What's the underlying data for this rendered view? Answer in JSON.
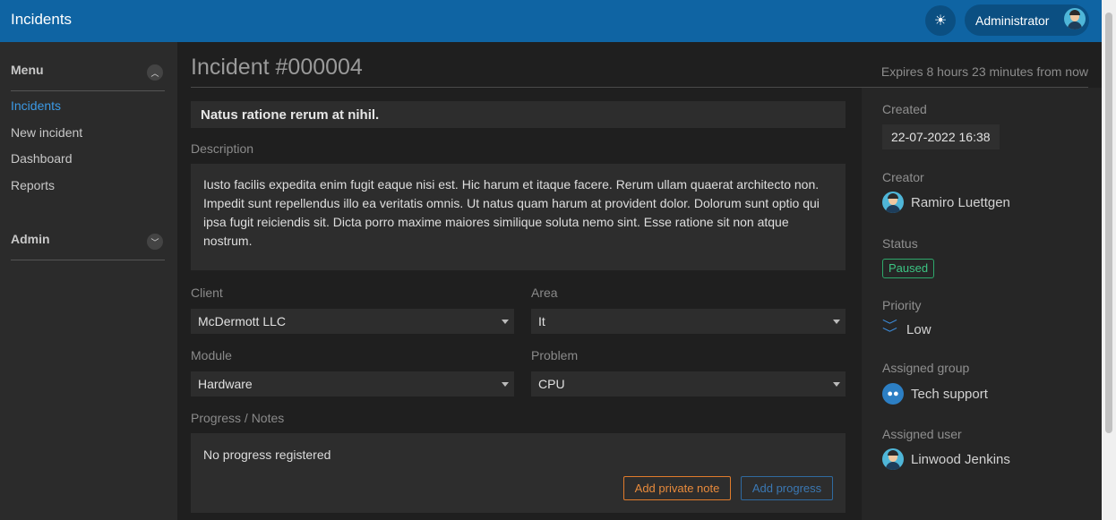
{
  "header": {
    "app_title": "Incidents",
    "theme_icon": "sun-icon",
    "user_name": "Administrator"
  },
  "sidebar": {
    "menu_title": "Menu",
    "items": [
      {
        "label": "Incidents",
        "active": true
      },
      {
        "label": "New incident",
        "active": false
      },
      {
        "label": "Dashboard",
        "active": false
      },
      {
        "label": "Reports",
        "active": false
      }
    ],
    "admin_title": "Admin"
  },
  "incident": {
    "title": "Incident #000004",
    "expires": "Expires 8 hours 23 minutes from now",
    "subject": "Natus ratione rerum at nihil.",
    "description_label": "Description",
    "description": "Iusto facilis expedita enim fugit eaque nisi est. Hic harum et itaque facere. Rerum ullam quaerat architecto non. Impedit sunt repellendus illo ea veritatis omnis. Ut natus quam harum at provident dolor. Dolorum sunt optio qui ipsa fugit reiciendis sit. Dicta porro maxime maiores similique soluta nemo sint. Esse ratione sit non atque nostrum.",
    "client_label": "Client",
    "client_value": "McDermott LLC",
    "area_label": "Area",
    "area_value": "It",
    "module_label": "Module",
    "module_value": "Hardware",
    "problem_label": "Problem",
    "problem_value": "CPU",
    "progress_label": "Progress / Notes",
    "progress_empty": "No progress registered",
    "add_note_label": "Add private note",
    "add_progress_label": "Add progress"
  },
  "details": {
    "created_label": "Created",
    "created_value": "22-07-2022 16:38",
    "creator_label": "Creator",
    "creator_value": "Ramiro Luettgen",
    "status_label": "Status",
    "status_value": "Paused",
    "priority_label": "Priority",
    "priority_value": "Low",
    "group_label": "Assigned group",
    "group_value": "Tech support",
    "user_label": "Assigned user",
    "user_value": "Linwood Jenkins"
  },
  "colors": {
    "header": "#0f64a3",
    "accent": "#3b9ae6",
    "status_paused": "#3cc483",
    "note_button": "#e88a3b",
    "progress_button": "#3b78b3"
  }
}
